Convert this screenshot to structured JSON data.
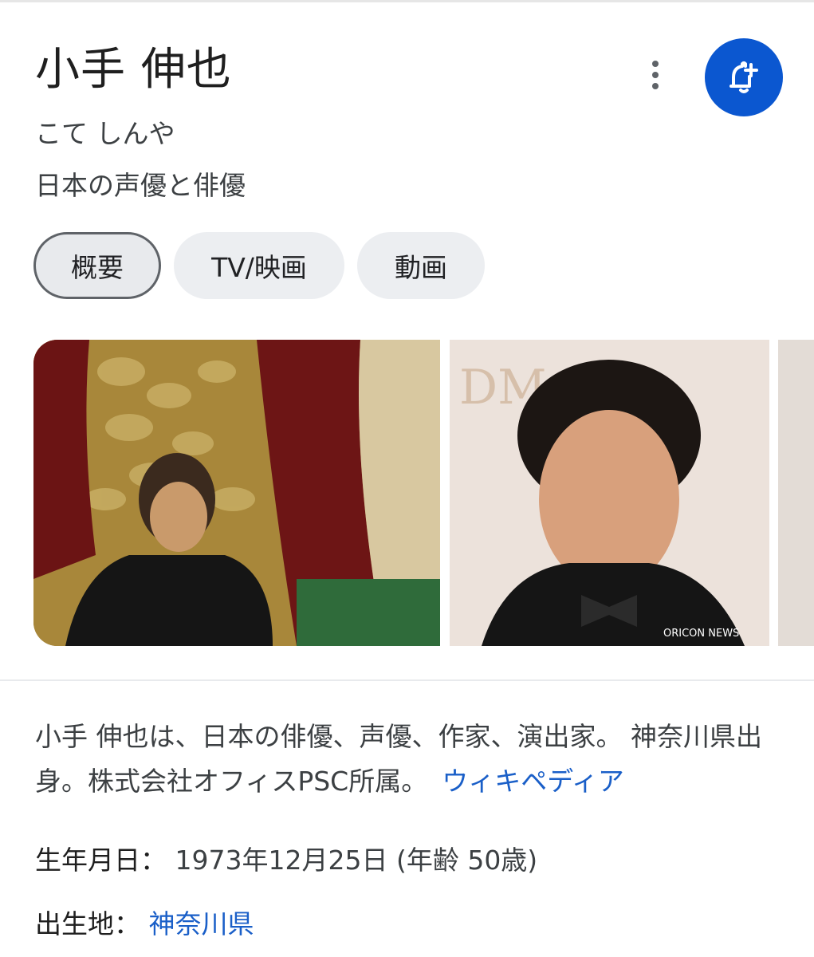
{
  "header": {
    "title": "小手 伸也",
    "kana": "こて しんや",
    "description": "日本の声優と俳優"
  },
  "actions": {
    "more_icon": "more-vert-icon",
    "follow_icon": "bell-add-icon",
    "accent_color": "#0b57d0"
  },
  "tabs": [
    {
      "label": "概要",
      "active": true
    },
    {
      "label": "TV/映画",
      "active": false
    },
    {
      "label": "動画",
      "active": false
    }
  ],
  "images": [
    {
      "watermark": ""
    },
    {
      "watermark": "ORICON NEWS"
    }
  ],
  "summary": {
    "text": "小手 伸也は、日本の俳優、声優、作家、演出家。 神奈川県出身。株式会社オフィスPSC所属。",
    "source_link": "ウィキペディア"
  },
  "facts": [
    {
      "label": "生年月日",
      "value": "1973年12月25日 (年齢 50歳)",
      "is_link": false
    },
    {
      "label": "出生地",
      "value": "神奈川県",
      "is_link": true
    }
  ]
}
